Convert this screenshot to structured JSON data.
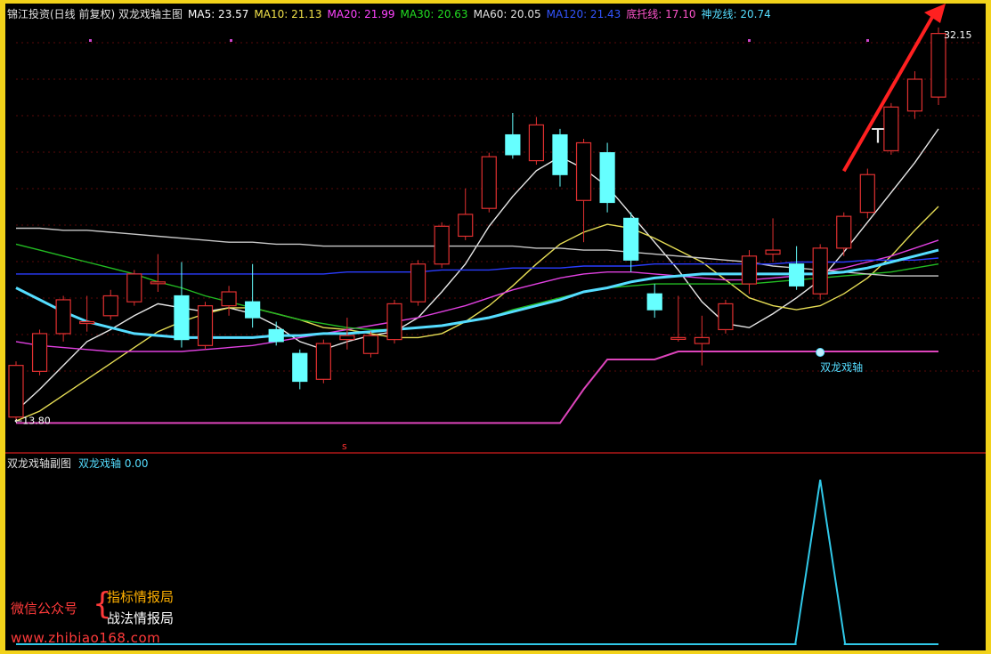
{
  "header": {
    "title": "锦江投资(日线 前复权) 双龙戏轴主图",
    "indicators": [
      {
        "label": "MA5: 23.57",
        "color": "#ffffff"
      },
      {
        "label": "MA10: 21.13",
        "color": "#f2e24a"
      },
      {
        "label": "MA20: 21.99",
        "color": "#ff44ff"
      },
      {
        "label": "MA30: 20.63",
        "color": "#22dd22"
      },
      {
        "label": "MA60: 20.05",
        "color": "#e0e0e0"
      },
      {
        "label": "MA120: 21.43",
        "color": "#3355ff"
      },
      {
        "label": "底托线: 17.10",
        "color": "#ff55cc"
      },
      {
        "label": "神龙线: 20.74",
        "color": "#55ddff"
      }
    ]
  },
  "sub_header": {
    "title": "双龙戏轴副图",
    "indicator": "双龙戏轴 0.00"
  },
  "annotations": {
    "max_label": "32.15",
    "min_label": "13.80",
    "signal_label": "双龙戏轴",
    "marker_label": "s"
  },
  "watermark": {
    "line1": "微信公众号",
    "brace": "{",
    "line2": "指标情报局",
    "line3": "战法情报局",
    "url": "www.zhibiao168.com"
  },
  "colors": {
    "background": "#000000",
    "border": "#f2d21a",
    "up": "#e03030",
    "down": "#66ffff",
    "arrow": "#ff2020",
    "divider": "#b01818"
  },
  "chart_data": [
    {
      "type": "candlestick",
      "title": "锦江投资(日线 前复权) 双龙戏轴主图",
      "ylim": [
        12.4,
        33.8
      ],
      "candles": [
        {
          "open": 13.8,
          "close": 16.4,
          "high": 16.6,
          "low": 13.6
        },
        {
          "open": 16.1,
          "close": 18.0,
          "high": 18.2,
          "low": 15.9
        },
        {
          "open": 18.0,
          "close": 19.7,
          "high": 19.9,
          "low": 17.6
        },
        {
          "open": 18.6,
          "close": 18.6,
          "high": 19.9,
          "low": 18.1
        },
        {
          "open": 18.9,
          "close": 19.9,
          "high": 20.2,
          "low": 18.7
        },
        {
          "open": 19.6,
          "close": 21.0,
          "high": 21.2,
          "low": 19.4
        },
        {
          "open": 20.6,
          "close": 20.6,
          "high": 22.0,
          "low": 20.1
        },
        {
          "open": 19.9,
          "close": 17.7,
          "high": 21.6,
          "low": 17.3
        },
        {
          "open": 17.4,
          "close": 19.4,
          "high": 19.6,
          "low": 17.2
        },
        {
          "open": 19.4,
          "close": 20.1,
          "high": 20.4,
          "low": 18.9
        },
        {
          "open": 19.6,
          "close": 18.8,
          "high": 21.5,
          "low": 18.3
        },
        {
          "open": 18.2,
          "close": 17.6,
          "high": 18.6,
          "low": 17.4
        },
        {
          "open": 17.0,
          "close": 15.6,
          "high": 17.2,
          "low": 15.2
        },
        {
          "open": 15.7,
          "close": 17.5,
          "high": 17.7,
          "low": 15.5
        },
        {
          "open": 17.7,
          "close": 17.9,
          "high": 18.8,
          "low": 17.2
        },
        {
          "open": 17.0,
          "close": 17.9,
          "high": 18.1,
          "low": 16.8
        },
        {
          "open": 17.7,
          "close": 19.5,
          "high": 19.7,
          "low": 17.5
        },
        {
          "open": 19.6,
          "close": 21.5,
          "high": 21.7,
          "low": 19.4
        },
        {
          "open": 21.5,
          "close": 23.4,
          "high": 23.6,
          "low": 21.3
        },
        {
          "open": 22.9,
          "close": 24.0,
          "high": 25.3,
          "low": 22.7
        },
        {
          "open": 24.3,
          "close": 26.9,
          "high": 27.1,
          "low": 24.1
        },
        {
          "open": 28.0,
          "close": 27.0,
          "high": 29.1,
          "low": 26.8
        },
        {
          "open": 26.7,
          "close": 28.5,
          "high": 28.9,
          "low": 26.5
        },
        {
          "open": 28.0,
          "close": 26.0,
          "high": 28.3,
          "low": 25.4
        },
        {
          "open": 24.7,
          "close": 27.6,
          "high": 27.8,
          "low": 22.6
        },
        {
          "open": 27.1,
          "close": 24.6,
          "high": 27.6,
          "low": 24.1
        },
        {
          "open": 23.8,
          "close": 21.7,
          "high": 24.1,
          "low": 21.1
        },
        {
          "open": 20.0,
          "close": 19.2,
          "high": 20.5,
          "low": 18.8
        },
        {
          "open": 17.8,
          "close": 17.8,
          "high": 19.9,
          "low": 17.6
        },
        {
          "open": 17.5,
          "close": 17.8,
          "high": 18.9,
          "low": 16.4
        },
        {
          "open": 18.2,
          "close": 19.5,
          "high": 19.7,
          "low": 18.0
        },
        {
          "open": 20.5,
          "close": 21.9,
          "high": 22.2,
          "low": 20.0
        },
        {
          "open": 22.0,
          "close": 22.2,
          "high": 23.8,
          "low": 21.6
        },
        {
          "open": 21.5,
          "close": 20.4,
          "high": 22.4,
          "low": 20.2
        },
        {
          "open": 20.0,
          "close": 22.3,
          "high": 22.5,
          "low": 19.7
        },
        {
          "open": 22.3,
          "close": 23.9,
          "high": 24.1,
          "low": 21.9
        },
        {
          "open": 24.1,
          "close": 26.0,
          "high": 26.3,
          "low": 23.8
        },
        {
          "open": 27.2,
          "close": 29.4,
          "high": 29.6,
          "low": 27.0
        },
        {
          "open": 29.2,
          "close": 30.8,
          "high": 31.2,
          "low": 28.8
        },
        {
          "open": 29.9,
          "close": 33.1,
          "high": 33.4,
          "low": 29.5
        }
      ],
      "lines": [
        {
          "name": "MA5",
          "color": "#e8e8e8",
          "values": [
            14.1,
            15.2,
            16.4,
            17.6,
            18.2,
            18.9,
            19.5,
            19.3,
            19.1,
            19.3,
            19.0,
            18.4,
            17.6,
            17.2,
            17.6,
            17.9,
            18.1,
            18.8,
            20.1,
            21.5,
            23.4,
            24.9,
            26.2,
            26.9,
            26.3,
            25.4,
            24.0,
            22.6,
            21.2,
            19.6,
            18.5,
            18.3,
            19.0,
            19.8,
            20.7,
            22.1,
            23.6,
            25.1,
            26.6,
            28.3
          ]
        },
        {
          "name": "MA10",
          "color": "#e6dd55",
          "values": [
            13.6,
            14.1,
            14.9,
            15.7,
            16.5,
            17.3,
            18.1,
            18.6,
            19.0,
            19.3,
            19.3,
            19.0,
            18.7,
            18.3,
            18.2,
            18.0,
            17.8,
            17.8,
            18.0,
            18.6,
            19.4,
            20.4,
            21.5,
            22.5,
            23.1,
            23.5,
            23.3,
            22.8,
            22.2,
            21.6,
            20.7,
            19.8,
            19.4,
            19.2,
            19.4,
            20.0,
            20.8,
            21.9,
            23.2,
            24.4
          ]
        },
        {
          "name": "MA20",
          "color": "#e040e0",
          "values": [
            17.6,
            17.4,
            17.3,
            17.2,
            17.1,
            17.1,
            17.1,
            17.1,
            17.2,
            17.3,
            17.4,
            17.6,
            17.8,
            18.0,
            18.2,
            18.4,
            18.6,
            18.8,
            19.1,
            19.4,
            19.8,
            20.2,
            20.5,
            20.8,
            21.0,
            21.1,
            21.1,
            21.0,
            20.9,
            20.8,
            20.7,
            20.7,
            20.8,
            20.9,
            21.1,
            21.3,
            21.6,
            21.9,
            22.3,
            22.7
          ]
        },
        {
          "name": "MA30",
          "color": "#22bb22",
          "values": [
            22.5,
            22.2,
            21.9,
            21.6,
            21.3,
            21.0,
            20.6,
            20.3,
            19.9,
            19.6,
            19.3,
            19.0,
            18.7,
            18.5,
            18.3,
            18.2,
            18.2,
            18.3,
            18.4,
            18.6,
            18.8,
            19.2,
            19.5,
            19.8,
            20.1,
            20.3,
            20.4,
            20.5,
            20.5,
            20.5,
            20.5,
            20.5,
            20.6,
            20.7,
            20.8,
            20.9,
            21.0,
            21.1,
            21.3,
            21.5
          ]
        },
        {
          "name": "MA60",
          "color": "#c8c8c8",
          "values": [
            23.3,
            23.3,
            23.2,
            23.2,
            23.1,
            23.0,
            22.9,
            22.8,
            22.7,
            22.6,
            22.6,
            22.5,
            22.5,
            22.4,
            22.4,
            22.4,
            22.4,
            22.4,
            22.4,
            22.4,
            22.4,
            22.4,
            22.3,
            22.3,
            22.2,
            22.2,
            22.1,
            22.0,
            21.9,
            21.8,
            21.7,
            21.6,
            21.4,
            21.3,
            21.2,
            21.1,
            21.0,
            20.9,
            20.9,
            20.9
          ]
        },
        {
          "name": "MA120",
          "color": "#2a3cff",
          "values": [
            21.0,
            21.0,
            21.0,
            21.0,
            21.0,
            21.0,
            21.0,
            21.0,
            21.0,
            21.0,
            21.0,
            21.0,
            21.0,
            21.0,
            21.1,
            21.1,
            21.1,
            21.1,
            21.2,
            21.2,
            21.2,
            21.3,
            21.3,
            21.3,
            21.4,
            21.4,
            21.4,
            21.5,
            21.5,
            21.5,
            21.5,
            21.5,
            21.5,
            21.6,
            21.6,
            21.6,
            21.7,
            21.7,
            21.7,
            21.8
          ]
        },
        {
          "name": "神龙线",
          "color": "#55ddff",
          "values": [
            20.3,
            19.7,
            19.1,
            18.6,
            18.3,
            18.0,
            17.9,
            17.8,
            17.8,
            17.8,
            17.8,
            17.9,
            17.9,
            18.0,
            18.0,
            18.1,
            18.2,
            18.3,
            18.4,
            18.6,
            18.8,
            19.1,
            19.4,
            19.7,
            20.1,
            20.3,
            20.6,
            20.8,
            20.9,
            21.0,
            21.0,
            21.0,
            21.0,
            21.0,
            21.0,
            21.1,
            21.3,
            21.6,
            21.9,
            22.2
          ]
        },
        {
          "name": "底托线",
          "color": "#dd44bb",
          "values": [
            13.5,
            13.5,
            13.5,
            13.5,
            13.5,
            13.5,
            13.5,
            13.5,
            13.5,
            13.5,
            13.5,
            13.5,
            13.5,
            13.5,
            13.5,
            13.5,
            13.5,
            13.5,
            13.5,
            13.5,
            13.5,
            13.5,
            13.5,
            13.5,
            15.2,
            16.7,
            16.7,
            16.7,
            17.1,
            17.1,
            17.1,
            17.1,
            17.1,
            17.1,
            17.1,
            17.1,
            17.1,
            17.1,
            17.1,
            17.1
          ]
        }
      ],
      "max_price": 32.15,
      "min_price": 13.8
    },
    {
      "type": "line",
      "title": "双龙戏轴副图",
      "series": [
        {
          "name": "双龙戏轴",
          "color": "#30c8e8",
          "values": [
            0,
            0,
            0,
            0,
            0,
            0,
            0,
            0,
            0,
            0,
            0,
            0,
            0,
            0,
            0,
            0,
            0,
            0,
            0,
            0,
            0,
            0,
            0,
            0,
            0,
            0,
            0,
            0,
            0,
            0,
            0,
            0,
            0,
            0,
            1,
            0,
            0,
            0,
            0,
            0
          ]
        }
      ],
      "ylim": [
        0,
        1.05
      ]
    }
  ]
}
